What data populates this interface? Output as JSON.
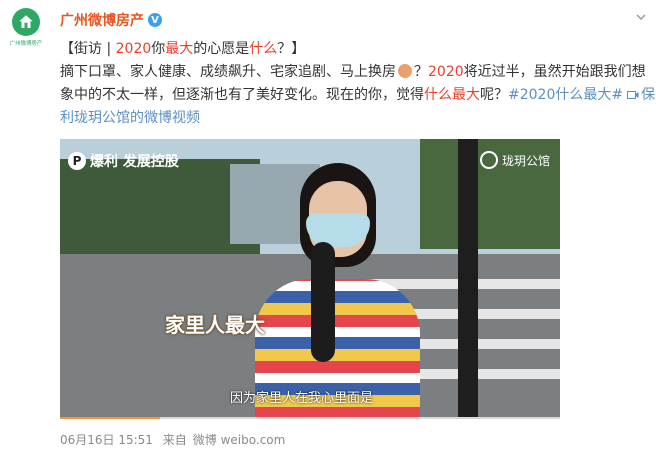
{
  "account": {
    "name": "广州微博房产",
    "avatar_label": "广州微博房产",
    "verified_badge": "V"
  },
  "post": {
    "line1": {
      "p1": "【街访 | ",
      "h1": "2020",
      "p2": "你",
      "h2": "最大",
      "p3": "的心愿是",
      "h3": "什么",
      "p4": "？】"
    },
    "line2": {
      "p1": "摘下口罩、家人健康、成绩飙升、宅家追剧、马上换房",
      "p2": "？",
      "h1": "2020",
      "p3": "将近过半，虽然开始跟我们想"
    },
    "line3": {
      "p1": "象中的不太一样，但逐渐也有了美好变化。现在的你，觉得",
      "h1": "什么最大",
      "p2": "呢？",
      "tag": "#2020什么最大#",
      "link_start": "保"
    },
    "line4": {
      "link_rest": "利珑玥公馆的微博视频"
    }
  },
  "video": {
    "watermark_left": "爆利 发展控股",
    "watermark_left_badge": "P",
    "watermark_right": "珑玥公馆",
    "caption_big": "家里人最大",
    "subtitle": "因为家里人在我心里面是",
    "progress": 0.2
  },
  "meta": {
    "date": "06月16日 15:51",
    "source_prefix": "来自",
    "source": "微博 weibo.com"
  },
  "colors": {
    "accent_orange": "#e8541e",
    "highlight_red": "#eb3f2c",
    "link_blue": "#5a8fc5",
    "brand_green": "#2fa866"
  }
}
